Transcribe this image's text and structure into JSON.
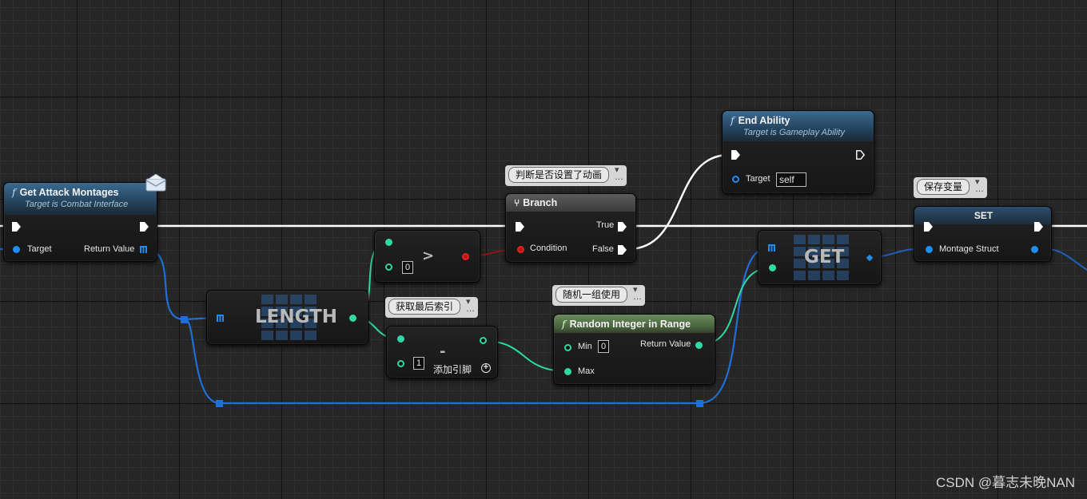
{
  "nodes": {
    "get_attack_montages": {
      "title": "Get Attack Montages",
      "subtitle": "Target is Combat Interface",
      "pin_target": "Target",
      "pin_return": "Return Value"
    },
    "length": {
      "label": "LENGTH"
    },
    "greater": {
      "op": ">",
      "value_b": "0"
    },
    "subtract": {
      "op": "-",
      "value_b": "1",
      "add_pin": "添加引脚"
    },
    "branch": {
      "title": "Branch",
      "pin_condition": "Condition",
      "pin_true": "True",
      "pin_false": "False"
    },
    "end_ability": {
      "title": "End Ability",
      "subtitle": "Target is Gameplay Ability",
      "pin_target": "Target",
      "target_value": "self"
    },
    "random_int": {
      "title": "Random Integer in Range",
      "pin_min": "Min",
      "min_value": "0",
      "pin_max": "Max",
      "pin_return": "Return Value"
    },
    "get": {
      "label": "GET"
    },
    "set": {
      "title": "SET",
      "pin_montage": "Montage Struct"
    }
  },
  "comments": {
    "branch": "判断是否设置了动画",
    "subtract": "获取最后索引",
    "random": "随机一组使用",
    "set": "保存变量"
  },
  "icons": {
    "function": "function-icon",
    "branch": "branch-icon",
    "message": "message-envelope-icon",
    "exec": "exec-pin-icon",
    "array": "array-grid-icon"
  },
  "colors": {
    "exec_wire": "#ffffff",
    "array_wire": "#1f6fd6",
    "integer_wire": "#2fd9a5",
    "bool_wire": "#8f1515",
    "struct_wire": "#1f5fb8"
  },
  "watermark": "CSDN @暮志未晚NAN"
}
